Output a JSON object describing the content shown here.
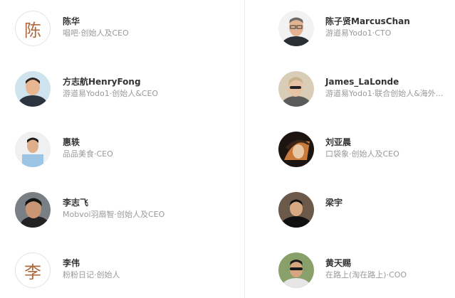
{
  "left": [
    {
      "avatar_char": "陈",
      "name": "陈华",
      "title": "唱吧·创始人及CEO"
    },
    {
      "avatar_char": "",
      "name": "方志航HenryFong",
      "title": "游道易Yodo1·创始人&CEO"
    },
    {
      "avatar_char": "",
      "name": "惠轶",
      "title": "品品美食·CEO"
    },
    {
      "avatar_char": "",
      "name": "李志飞",
      "title": "Mobvoi羽扇智·创始人及CEO"
    },
    {
      "avatar_char": "李",
      "name": "李伟",
      "title": "粉粉日记·创始人"
    }
  ],
  "right": [
    {
      "name": "陈子贤MarcusChan",
      "title": "游道易Yodo1·CTO"
    },
    {
      "name": "James_LaLonde",
      "title": "游道易Yodo1·联合创始人&海外..."
    },
    {
      "name": "刘亚晨",
      "title": "口袋象·创始人及CEO"
    },
    {
      "name": "梁宇",
      "title": ""
    },
    {
      "name": "黄天赐",
      "title": "在路上(淘在路上)·COO"
    }
  ],
  "colors": {
    "accent": "#b0683d",
    "name": "#333333",
    "title": "#999999",
    "divider": "#ececec"
  }
}
